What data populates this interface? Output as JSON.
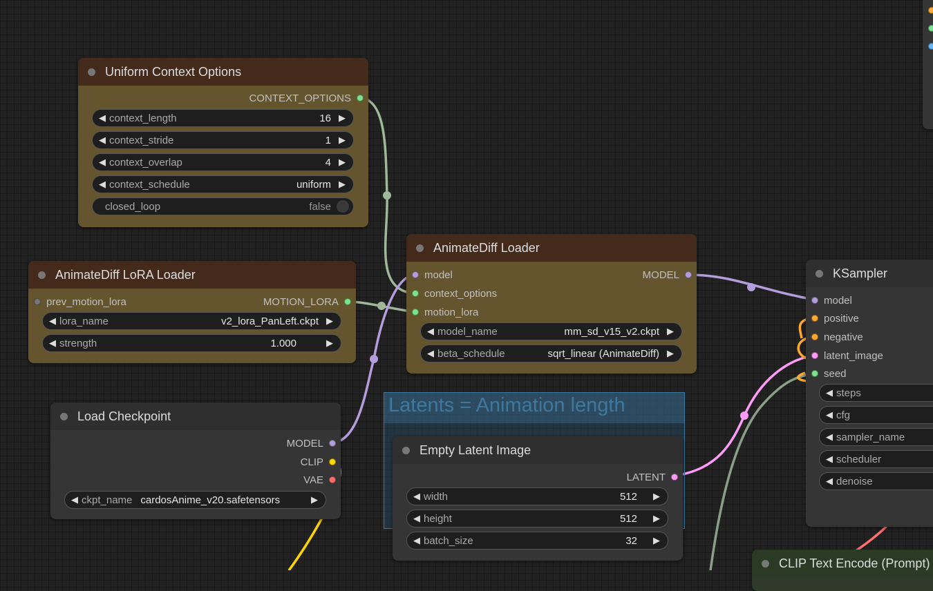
{
  "colors": {
    "model_wire": "#b39ddb",
    "clip_wire": "#ffd500",
    "vae_wire": "#ff6e6e",
    "context_wire": "#a0b89a",
    "lora_wire": "#a0b89a",
    "latent_wire": "#ff9cf9",
    "seed_wire": "#8a9f88",
    "conditioning_wire": "#ffa931"
  },
  "group": {
    "title": "Latents = Animation length"
  },
  "uniform_context": {
    "title": "Uniform Context Options",
    "output": "CONTEXT_OPTIONS",
    "widgets": [
      {
        "label": "context_length",
        "value": "16"
      },
      {
        "label": "context_stride",
        "value": "1"
      },
      {
        "label": "context_overlap",
        "value": "4"
      },
      {
        "label": "context_schedule",
        "value": "uniform"
      }
    ],
    "toggle": {
      "label": "closed_loop",
      "value": "false"
    }
  },
  "lora_loader": {
    "title": "AnimateDiff LoRA Loader",
    "input": "prev_motion_lora",
    "output": "MOTION_LORA",
    "widgets": [
      {
        "label": "lora_name",
        "value": "v2_lora_PanLeft.ckpt"
      },
      {
        "label": "strength",
        "value": "1.000"
      }
    ]
  },
  "animatediff_loader": {
    "title": "AnimateDiff Loader",
    "inputs": [
      "model",
      "context_options",
      "motion_lora"
    ],
    "output": "MODEL",
    "widgets": [
      {
        "label": "model_name",
        "value": "mm_sd_v15_v2.ckpt"
      },
      {
        "label": "beta_schedule",
        "value": "sqrt_linear (AnimateDiff)"
      }
    ]
  },
  "checkpoint": {
    "title": "Load Checkpoint",
    "outputs": [
      "MODEL",
      "CLIP",
      "VAE"
    ],
    "widget": {
      "label": "ckpt_name",
      "value": "cardosAnime_v20.safetensors"
    }
  },
  "empty_latent": {
    "title": "Empty Latent Image",
    "output": "LATENT",
    "widgets": [
      {
        "label": "width",
        "value": "512"
      },
      {
        "label": "height",
        "value": "512"
      },
      {
        "label": "batch_size",
        "value": "32"
      }
    ]
  },
  "ksampler": {
    "title": "KSampler",
    "inputs": [
      "model",
      "positive",
      "negative",
      "latent_image",
      "seed"
    ],
    "widgets": [
      "steps",
      "cfg",
      "sampler_name",
      "scheduler",
      "denoise"
    ]
  },
  "clip_text": {
    "title": "CLIP Text Encode (Prompt)"
  }
}
